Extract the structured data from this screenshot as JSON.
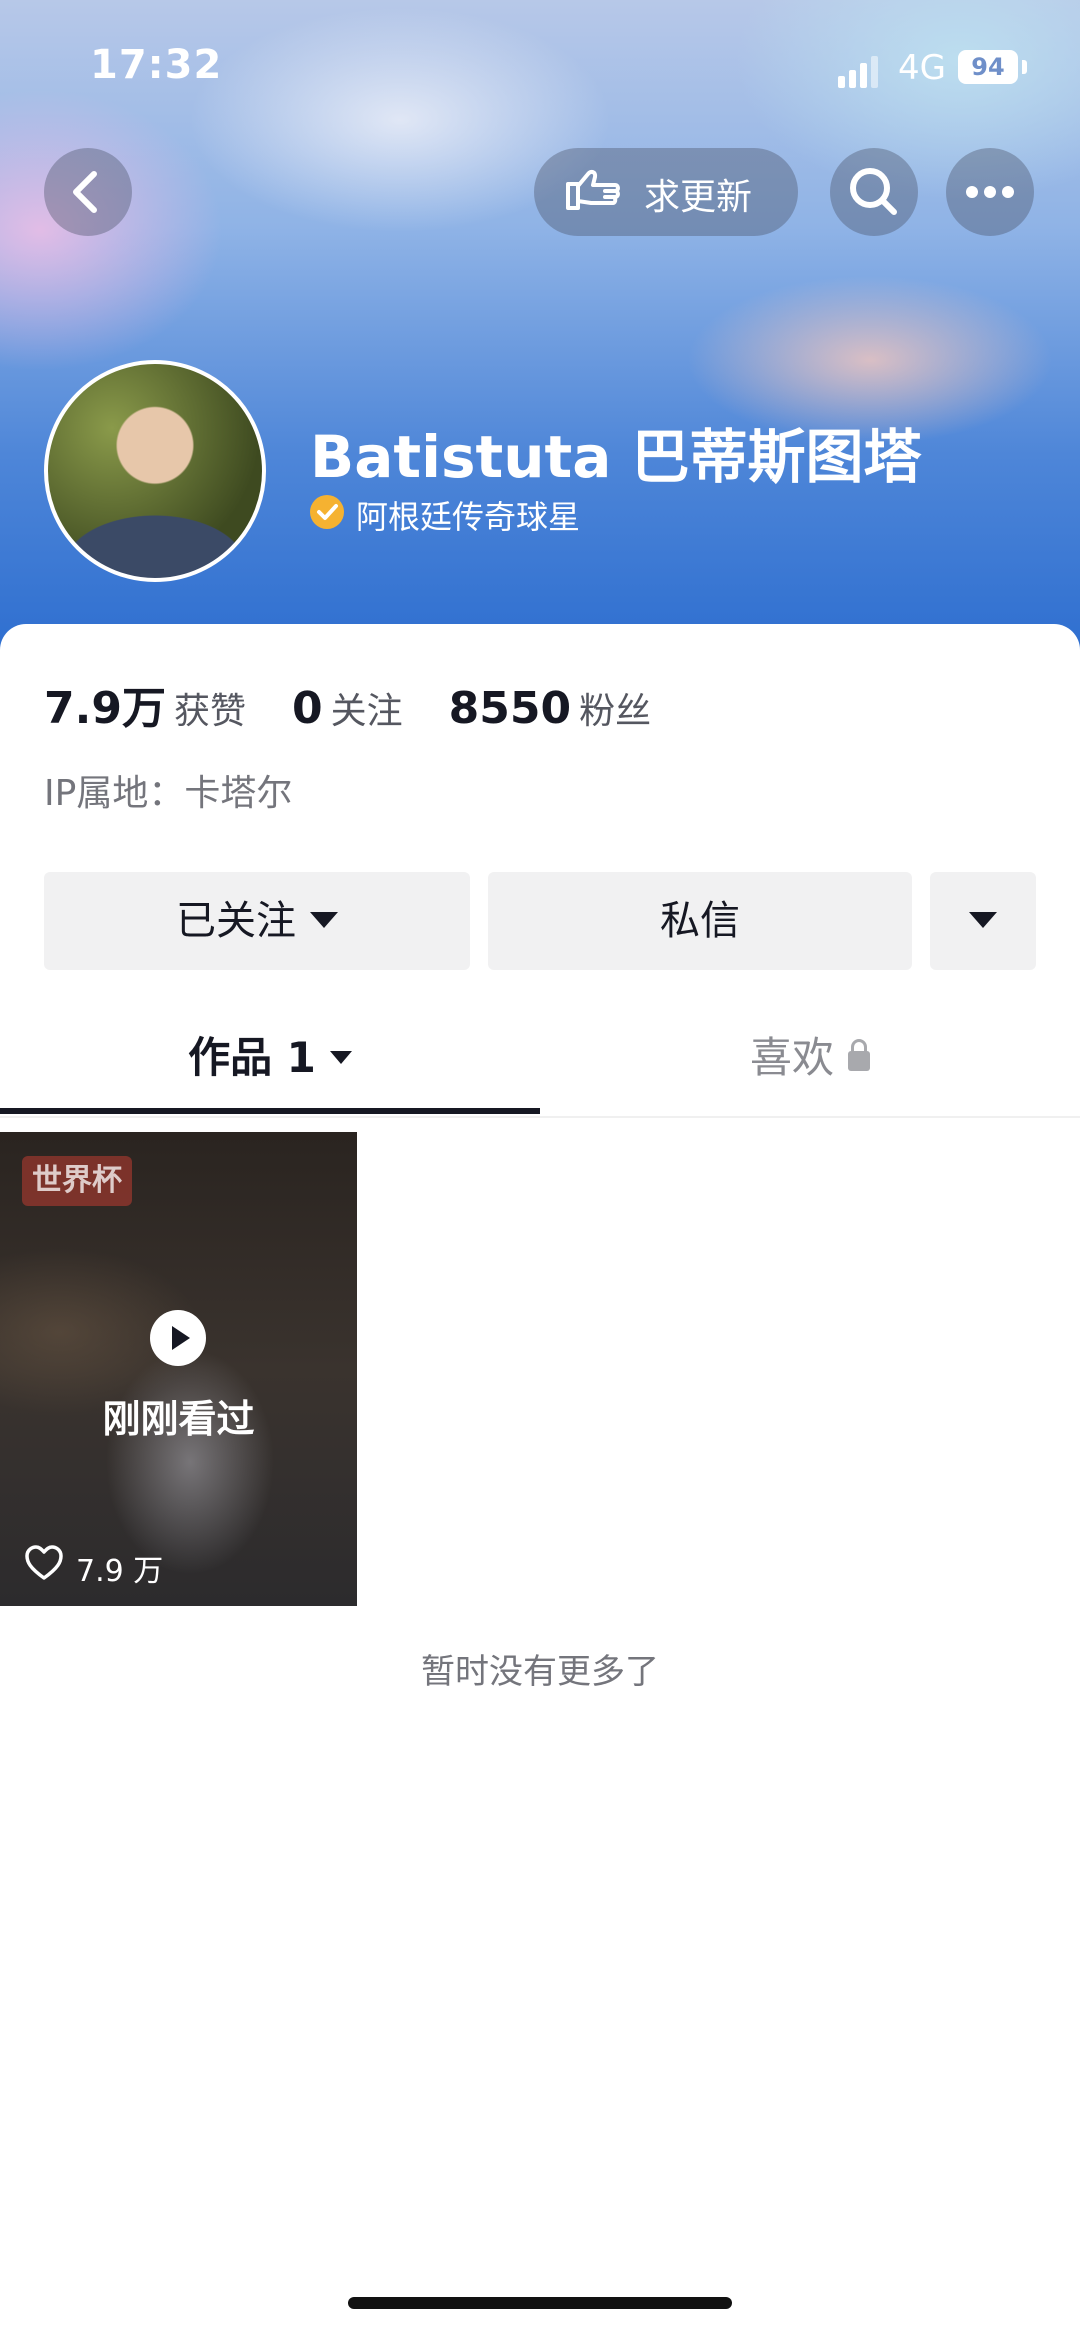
{
  "status_bar": {
    "time": "17:32",
    "network": "4G",
    "battery": "94"
  },
  "top_nav": {
    "update_label": "求更新"
  },
  "profile": {
    "name": "Batistuta 巴蒂斯图塔",
    "verification": "阿根廷传奇球星",
    "stats": [
      {
        "value": "7.9万",
        "label": "获赞"
      },
      {
        "value": "0",
        "label": "关注"
      },
      {
        "value": "8550",
        "label": "粉丝"
      }
    ],
    "ip_location": "IP属地：卡塔尔"
  },
  "actions": {
    "follow_label": "已关注",
    "message_label": "私信"
  },
  "tabs": [
    {
      "label": "作品 1",
      "active": true
    },
    {
      "label": "喜欢",
      "active": false
    }
  ],
  "videos": [
    {
      "tag": "世界杯",
      "overlay": "刚刚看过",
      "likes": "7.9 万"
    }
  ],
  "footer_note": "暂时没有更多了",
  "colors": {
    "verify_badge": "#f5b231",
    "text_primary": "#161823",
    "text_secondary": "#74757c"
  }
}
